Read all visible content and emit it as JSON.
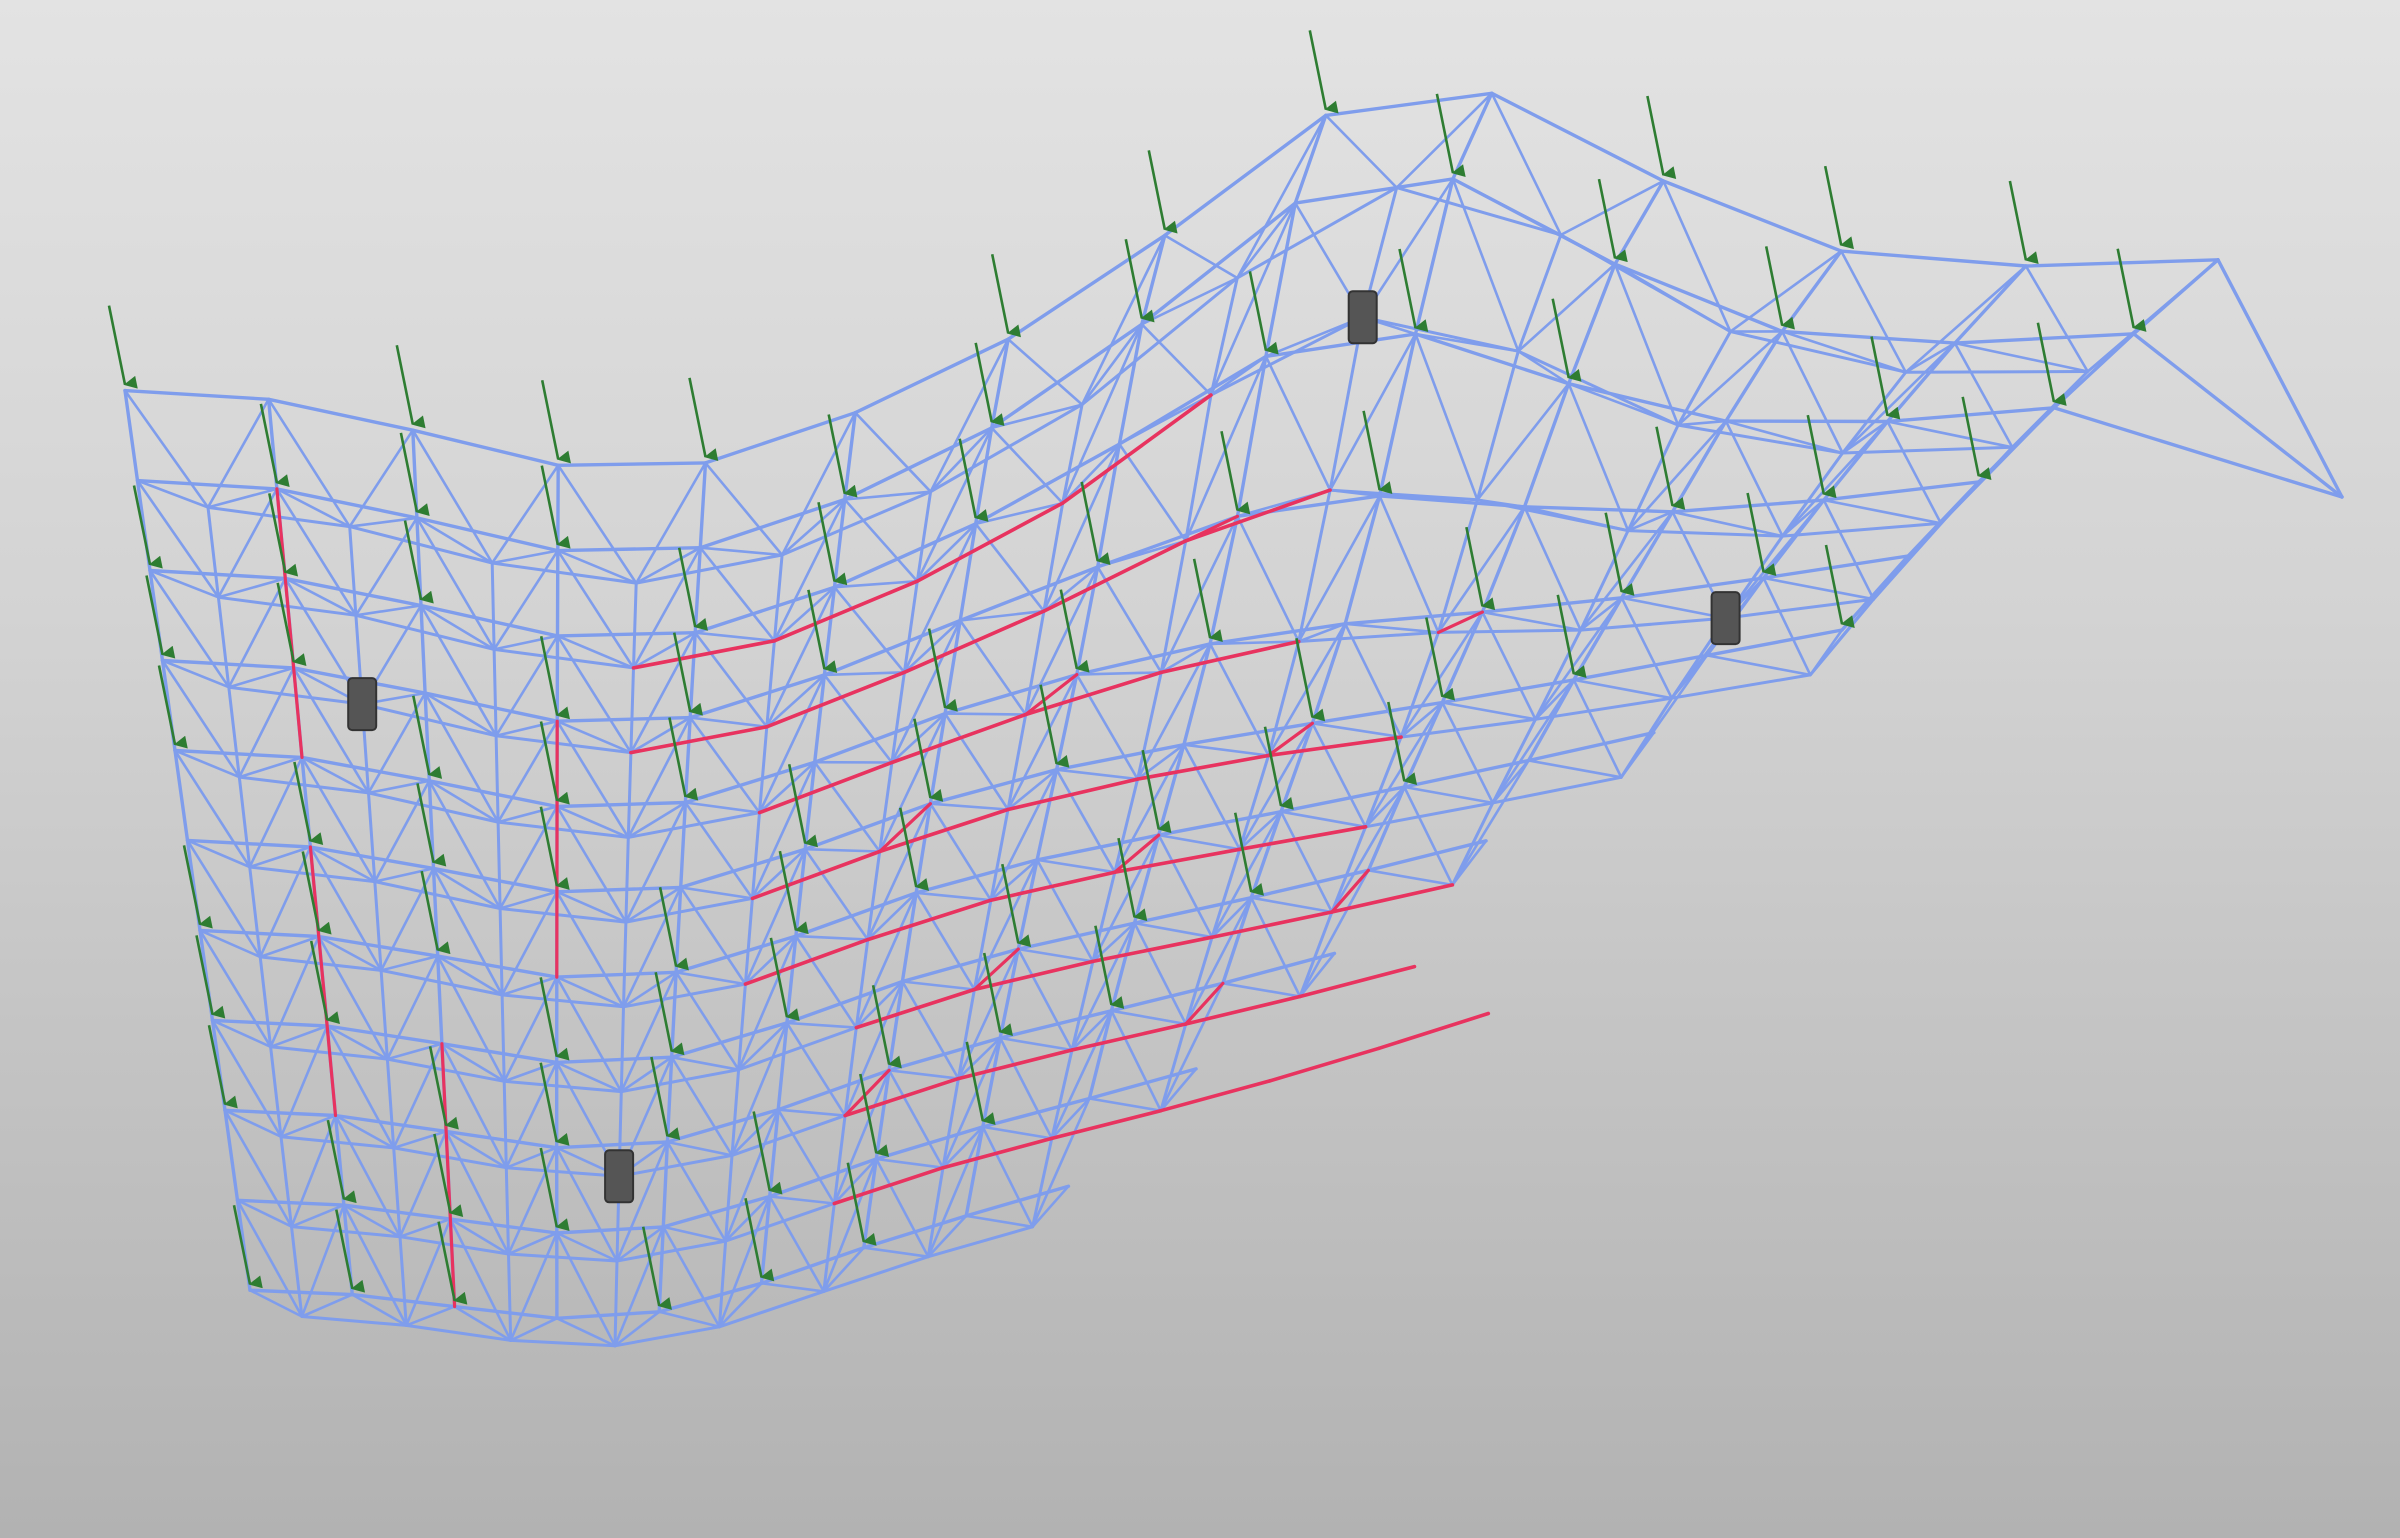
{
  "scene": {
    "description_hidden": "",
    "colors": {
      "background_top": "#e3e3e3",
      "background_bottom": "#b2b2b2",
      "member_default": "#7f9dec",
      "member_highlight": "#e8335f",
      "load_arrow": "#2e7d32",
      "support": "#555555"
    },
    "icons": [
      "load-arrow-icon",
      "support-bearing-icon"
    ],
    "grid": {
      "columns": 13,
      "rows": 10
    }
  }
}
